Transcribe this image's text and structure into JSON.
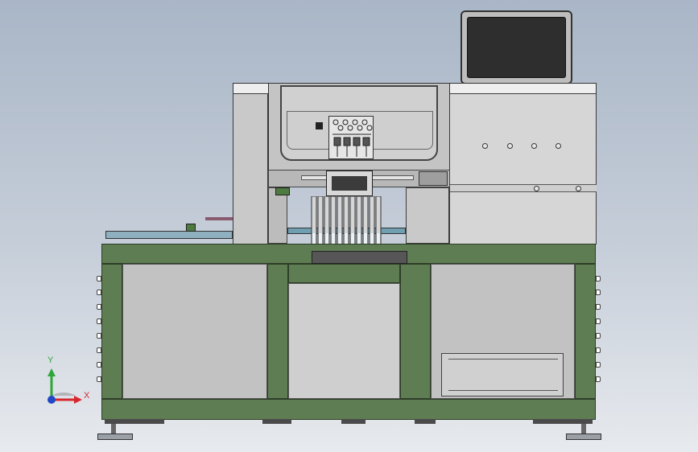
{
  "viewport": {
    "triad": {
      "x_label": "X",
      "y_label": "Y",
      "x_color": "#d8272e",
      "y_color": "#2fa63a",
      "z_color": "#2348c7"
    }
  },
  "colors": {
    "frame_green": "#5f7d53",
    "sheet_metal": "#c9c9c9",
    "monitor_screen": "#2e2e2e"
  }
}
